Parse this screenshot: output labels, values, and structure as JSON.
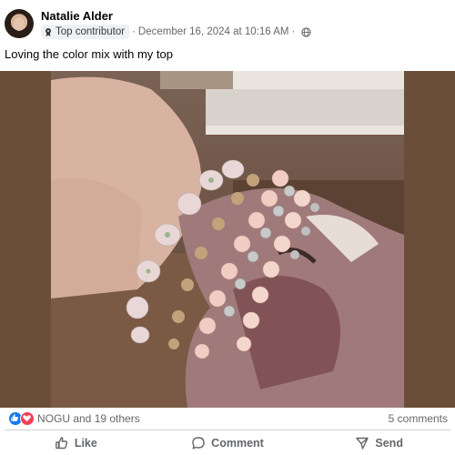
{
  "post": {
    "author": "Natalie Alder",
    "badge": "Top contributor",
    "date": "December 16, 2024 at 10:16 AM",
    "separator": "·",
    "caption": "Loving the color mix with my top"
  },
  "reactions": {
    "summary": "NOGU and 19 others",
    "comments": "5 comments"
  },
  "actions": {
    "like": "Like",
    "comment": "Comment",
    "send": "Send"
  },
  "colors": {
    "like_blue": "#1877f2",
    "love_red": "#f33e58",
    "muted_text": "#65676b"
  },
  "icons": {
    "badge": "trophy-icon",
    "audience": "globe-icon",
    "like": "thumbs-up-icon",
    "comment": "speech-bubble-icon",
    "send": "paper-plane-icon"
  }
}
